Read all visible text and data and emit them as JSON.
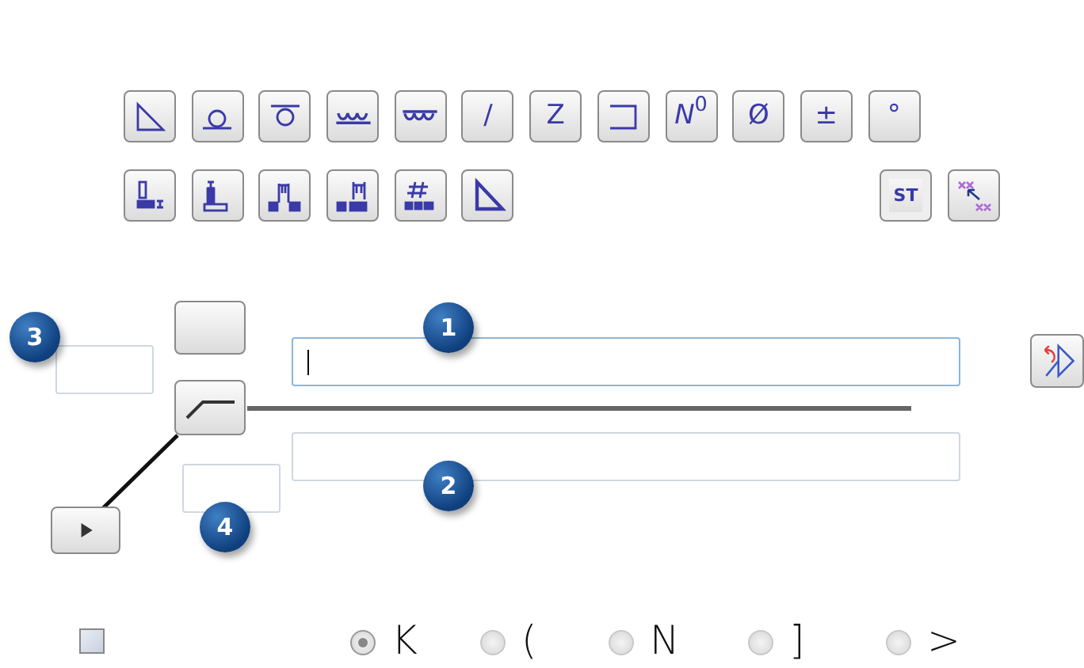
{
  "symbol_buttons_row_1": [
    {
      "kind": "icon"
    },
    {
      "kind": "icon"
    },
    {
      "kind": "icon"
    },
    {
      "kind": "icon"
    },
    {
      "kind": "icon"
    },
    {
      "kind": "text",
      "label": "/"
    },
    {
      "kind": "text",
      "label": "Z"
    },
    {
      "kind": "icon"
    },
    {
      "kind": "text",
      "label": "*N*$^{0}$"
    },
    {
      "kind": "text",
      "label": "Ø"
    },
    {
      "kind": "text",
      "label": "±"
    },
    {
      "kind": "text",
      "label": "°"
    }
  ],
  "symbol_buttons_row_2": [
    {
      "kind": "icon"
    },
    {
      "kind": "icon"
    },
    {
      "kind": "icon"
    },
    {
      "kind": "icon"
    },
    {
      "kind": "icon"
    },
    {
      "kind": "icon"
    }
  ],
  "symbol_buttons_row_2_right": [
    {
      "kind": "text",
      "label": "ST"
    },
    {
      "kind": "icon"
    }
  ],
  "callouts": [
    "1",
    "2",
    "3",
    "4"
  ],
  "above_field": {
    "focused": true
  },
  "below_field": {
    "focused": false
  },
  "checkbox": {
    "checked": false
  },
  "options": [
    {
      "label": "K",
      "selected": true
    },
    {
      "label": "(",
      "selected": false
    },
    {
      "label": "N",
      "selected": false
    },
    {
      "label": "]",
      "selected": false
    },
    {
      "label": ">",
      "selected": false
    }
  ]
}
